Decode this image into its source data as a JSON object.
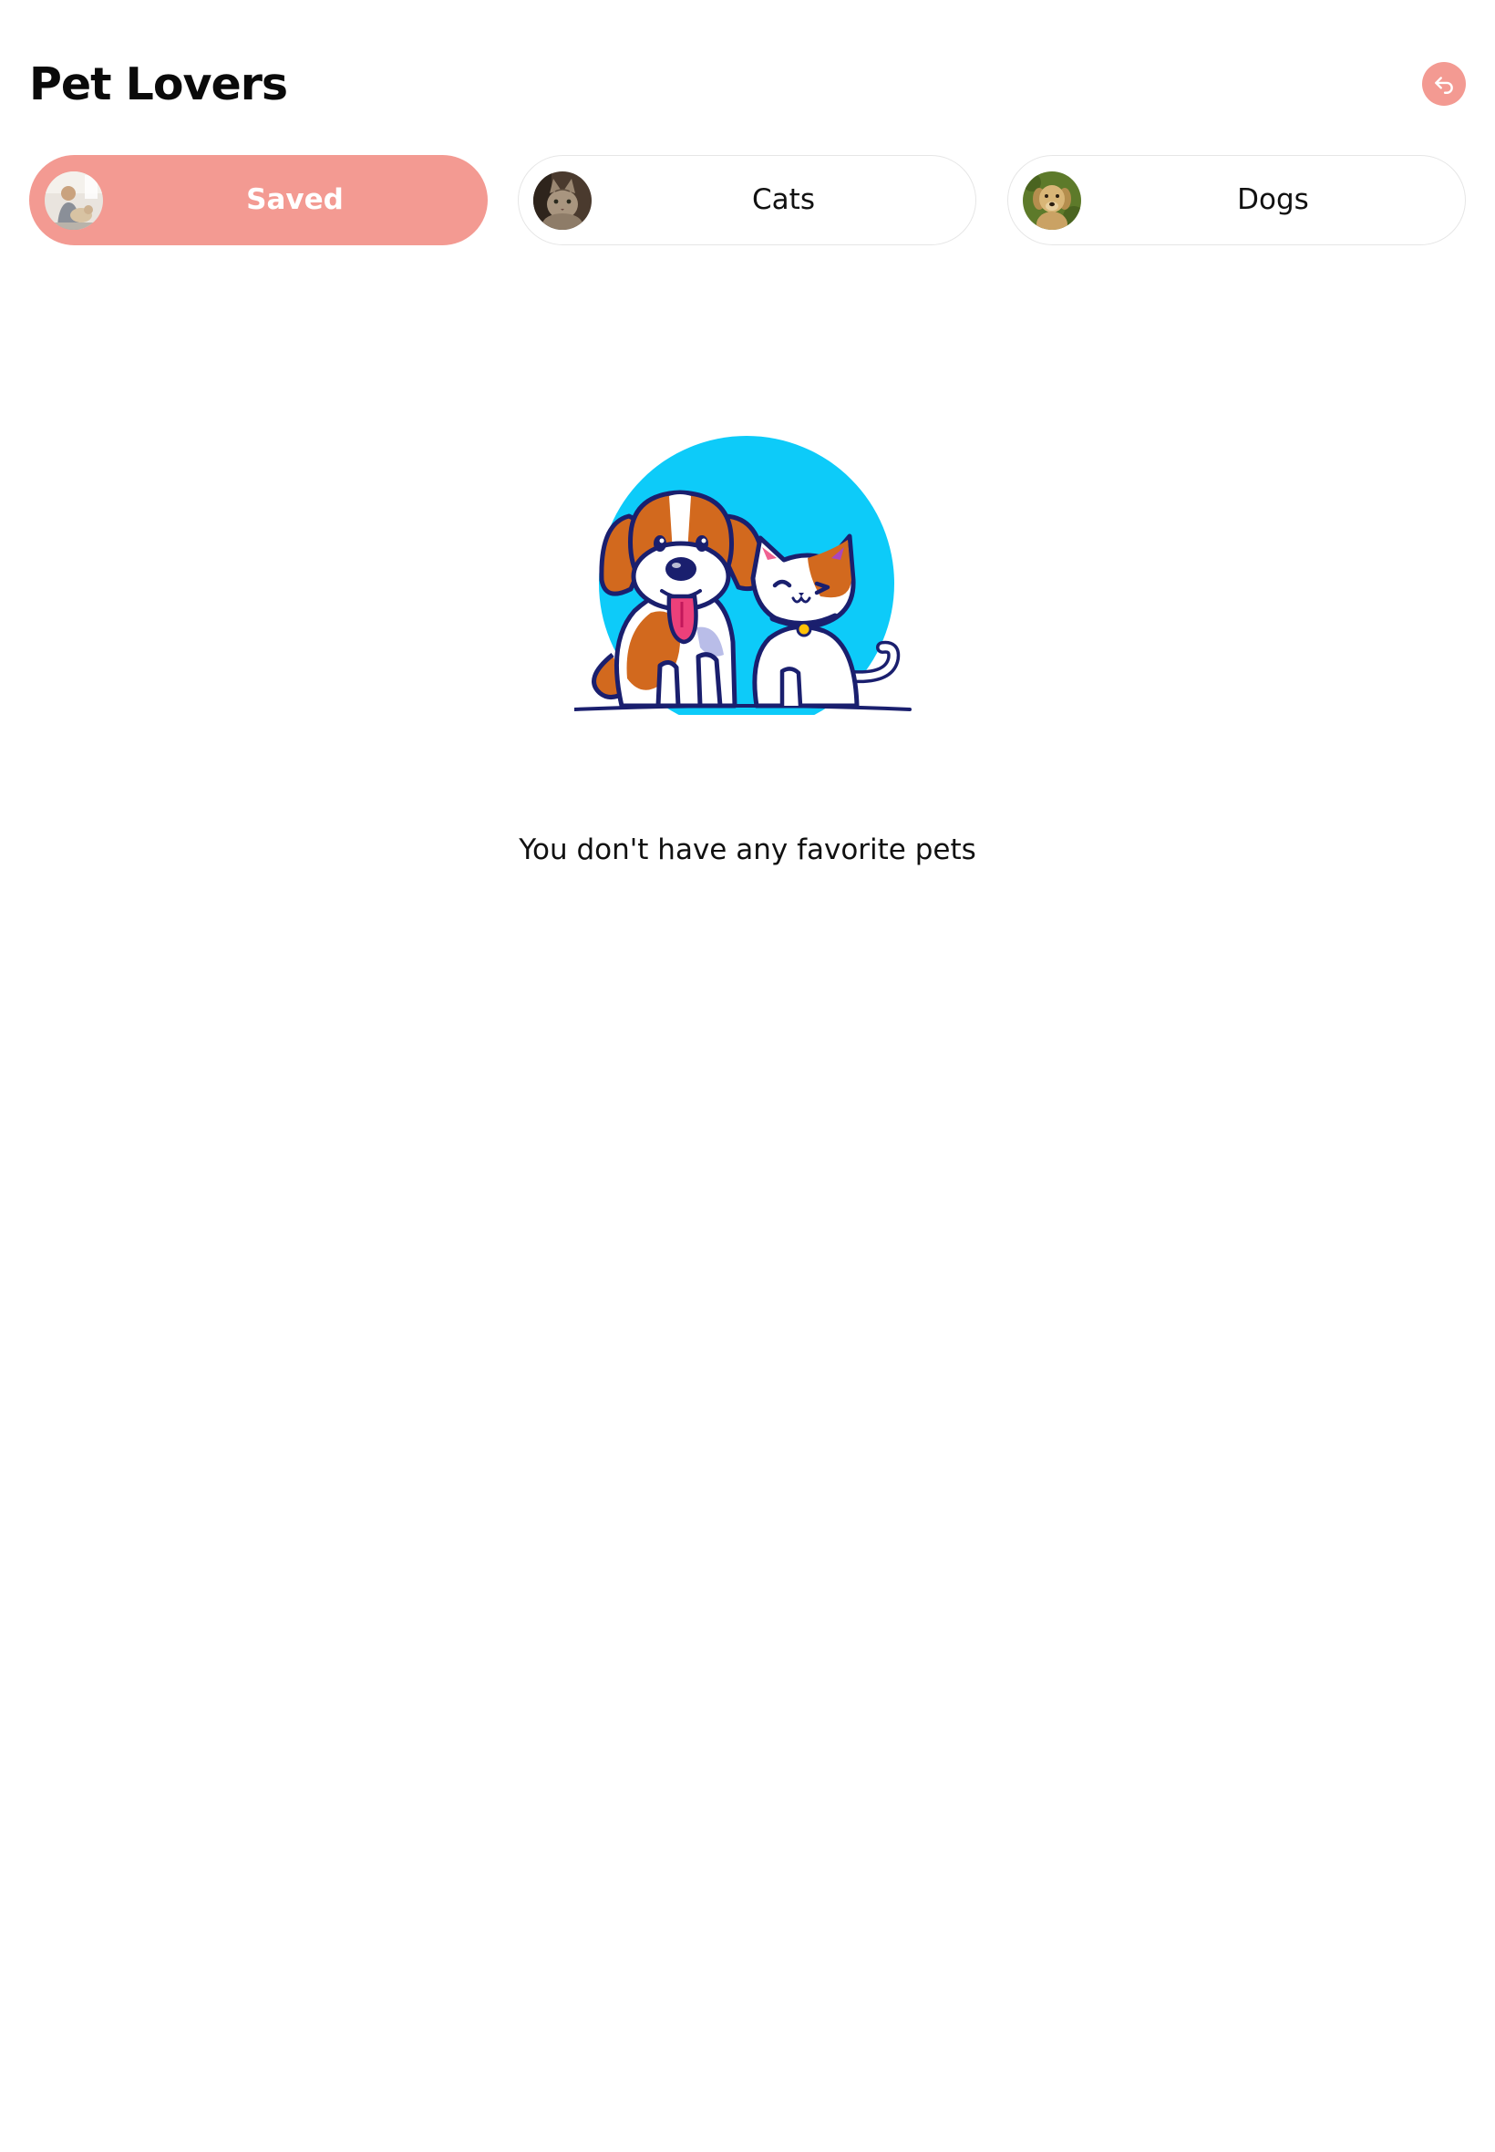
{
  "app": {
    "title": "Pet Lovers",
    "accent_color": "#f39a92"
  },
  "header": {
    "back_icon": "return-arrow-icon"
  },
  "tabs": [
    {
      "label": "Saved",
      "active": true,
      "avatar": "woman-with-dog-photo"
    },
    {
      "label": "Cats",
      "active": false,
      "avatar": "cat-photo"
    },
    {
      "label": "Dogs",
      "active": false,
      "avatar": "golden-retriever-photo"
    }
  ],
  "empty_state": {
    "illustration": "dog-and-cat-illustration",
    "message": "You don't have any favorite pets"
  }
}
